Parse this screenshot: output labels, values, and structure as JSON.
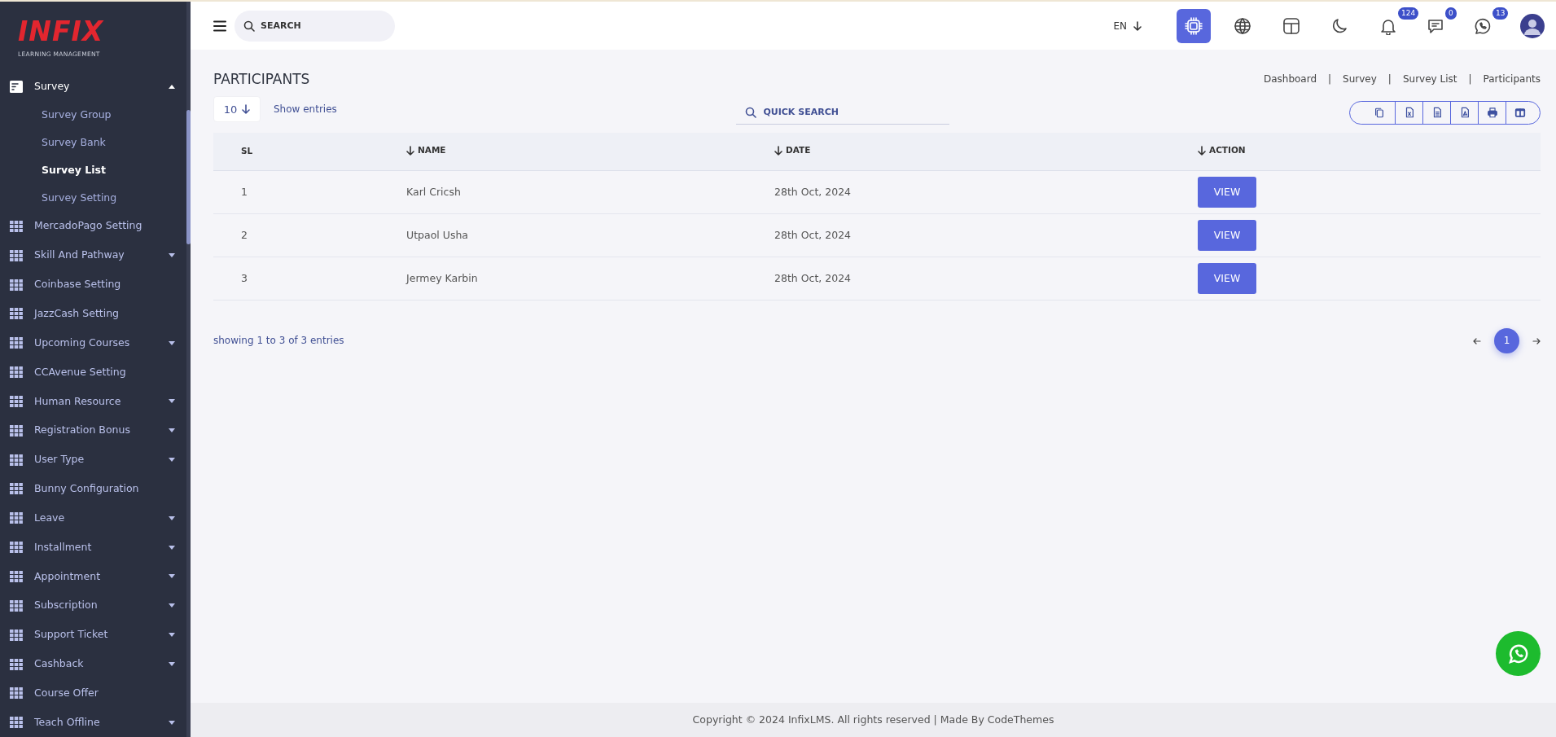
{
  "sidebar": {
    "logo": {
      "title": "INFIX",
      "subtitle": "LEARNING MANAGEMENT"
    },
    "items": [
      {
        "label": "Survey",
        "kind": "document",
        "expanded": true,
        "children": [
          {
            "label": "Survey Group",
            "selected": false
          },
          {
            "label": "Survey Bank",
            "selected": false
          },
          {
            "label": "Survey List",
            "selected": true
          },
          {
            "label": "Survey Setting",
            "selected": false
          }
        ]
      },
      {
        "label": "MercadoPago Setting",
        "kind": "grid"
      },
      {
        "label": "Skill And Pathway",
        "kind": "grid",
        "expanded": false
      },
      {
        "label": "Coinbase Setting",
        "kind": "grid"
      },
      {
        "label": "JazzCash Setting",
        "kind": "grid"
      },
      {
        "label": "Upcoming Courses",
        "kind": "grid",
        "expanded": false
      },
      {
        "label": "CCAvenue Setting",
        "kind": "grid"
      },
      {
        "label": "Human Resource",
        "kind": "grid",
        "expanded": false
      },
      {
        "label": "Registration Bonus",
        "kind": "grid",
        "expanded": false
      },
      {
        "label": "User Type",
        "kind": "grid",
        "expanded": false
      },
      {
        "label": "Bunny Configuration",
        "kind": "grid"
      },
      {
        "label": "Leave",
        "kind": "grid",
        "expanded": false
      },
      {
        "label": "Installment",
        "kind": "grid",
        "expanded": false
      },
      {
        "label": "Appointment",
        "kind": "grid",
        "expanded": false
      },
      {
        "label": "Subscription",
        "kind": "grid",
        "expanded": false
      },
      {
        "label": "Support Ticket",
        "kind": "grid",
        "expanded": false
      },
      {
        "label": "Cashback",
        "kind": "grid",
        "expanded": false
      },
      {
        "label": "Course Offer",
        "kind": "grid"
      },
      {
        "label": "Teach Offline",
        "kind": "grid",
        "expanded": false
      }
    ]
  },
  "topbar": {
    "search": {
      "placeholder": "SEARCH"
    },
    "language": "EN",
    "icons": [
      {
        "kind": "ai",
        "selected": true
      },
      {
        "kind": "globe",
        "selected": false
      },
      {
        "kind": "layout",
        "selected": false
      },
      {
        "kind": "moon",
        "selected": false
      },
      {
        "kind": "bell",
        "selected": false,
        "badge": "124"
      },
      {
        "kind": "chat",
        "selected": false,
        "badge": "0"
      },
      {
        "kind": "whatsapp",
        "selected": false,
        "badge": "13"
      }
    ]
  },
  "page": {
    "title": "PARTICIPANTS",
    "breadcrumb": [
      {
        "label": "Dashboard",
        "separator": "|"
      },
      {
        "label": "Survey",
        "separator": "|"
      },
      {
        "label": "Survey List",
        "separator": "|"
      },
      {
        "label": "Participants"
      }
    ],
    "page_size": "10",
    "page_size_label": "Show entries",
    "quick_search": {
      "placeholder": "QUICK SEARCH"
    },
    "export_buttons": [
      {
        "kind": "copy"
      },
      {
        "kind": "excel"
      },
      {
        "kind": "csv"
      },
      {
        "kind": "pdf"
      },
      {
        "kind": "print"
      },
      {
        "kind": "columns"
      }
    ],
    "table": {
      "columns": [
        {
          "label": "SL",
          "sortable": false
        },
        {
          "label": "NAME",
          "sortable": true
        },
        {
          "label": "DATE",
          "sortable": true
        },
        {
          "label": "ACTION",
          "sortable": true
        }
      ],
      "rows": [
        {
          "sl": "1",
          "name": "Karl Cricsh",
          "date": "28th Oct, 2024",
          "action": "VIEW"
        },
        {
          "sl": "2",
          "name": "Utpaol Usha",
          "date": "28th Oct, 2024",
          "action": "VIEW"
        },
        {
          "sl": "3",
          "name": "Jermey Karbin",
          "date": "28th Oct, 2024",
          "action": "VIEW"
        }
      ]
    },
    "info": "showing 1 to 3 of 3 entries",
    "pagination": [
      {
        "label": "1",
        "selected": true
      }
    ]
  },
  "footer": "Copyright © 2024 InfixLMS. All rights reserved | Made By CodeThemes"
}
